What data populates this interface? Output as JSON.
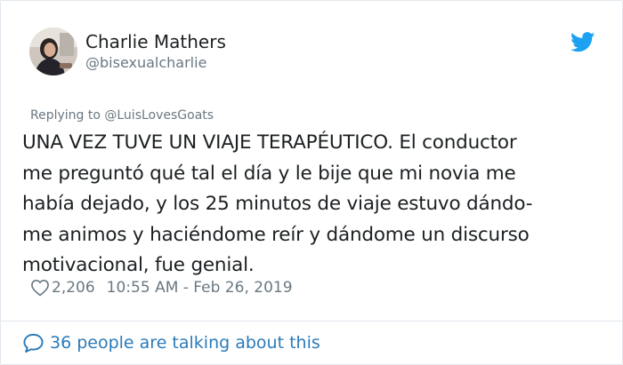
{
  "author": {
    "name": "Charlie Mathers",
    "handle": "@bisexualcharlie"
  },
  "reply": {
    "text": "Replying to @LuisLovesGoats"
  },
  "tweet": {
    "lines": [
      "UNA VEZ TUVE UN VIAJE TERAPÉUTICO. El conductor",
      "me preguntó qué tal el día y le bije que mi novia me",
      "había dejado, y los 25 minutos de viaje estuvo dándo-",
      "me animos y haciéndome reír y dándome un discurso",
      "motivacional, fue genial."
    ]
  },
  "meta": {
    "likes": "2,206",
    "timestamp": "10:55 AM - Feb 26, 2019"
  },
  "footer": {
    "talking": "36 people are talking about this"
  },
  "icons": {
    "brand": "twitter-bird-icon",
    "like": "heart-icon",
    "reply": "speech-bubble-icon"
  },
  "colors": {
    "twitter_blue": "#1da1f2",
    "link_blue": "#2b7bb9",
    "meta_gray": "#697882",
    "text": "#1c2022",
    "border": "#e1e8ed"
  }
}
